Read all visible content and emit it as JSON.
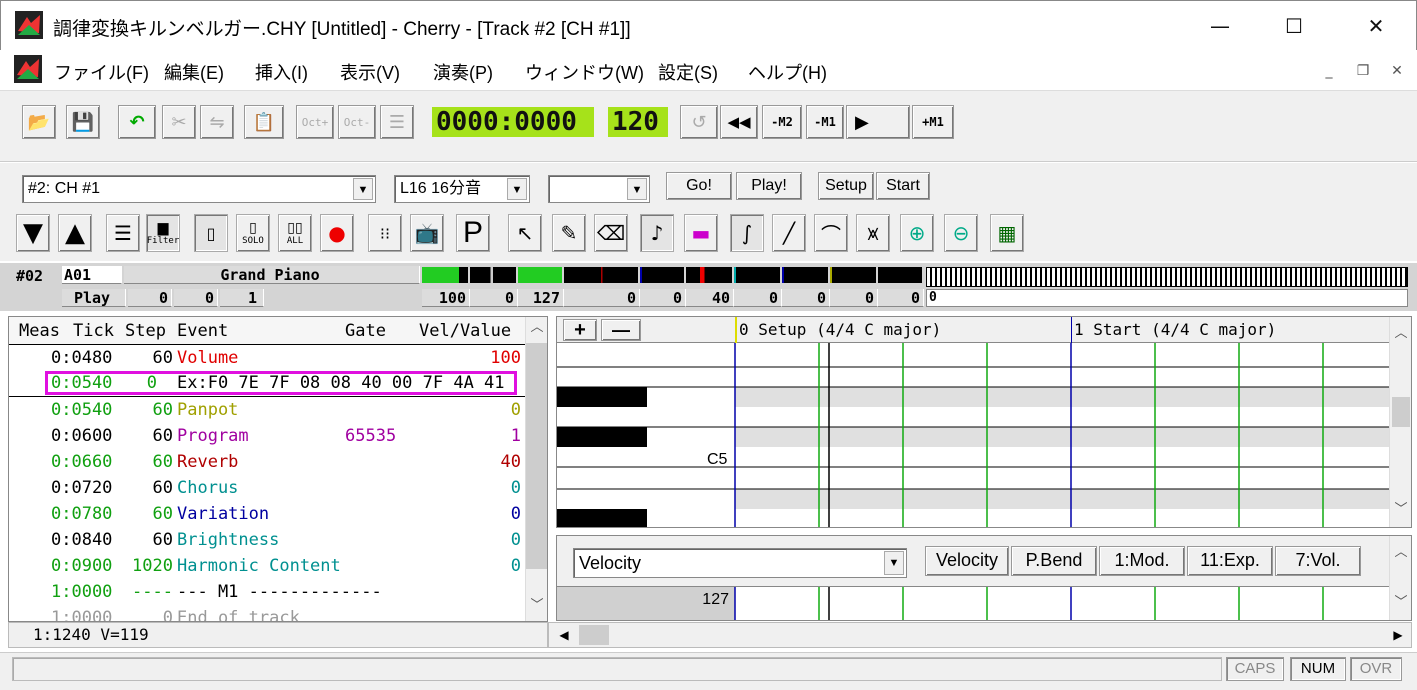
{
  "window": {
    "title": "調律変換キルンベルガー.CHY [Untitled] - Cherry  - [Track #2 [CH #1]]",
    "minimize": "—",
    "maximize": "☐",
    "close": "✕"
  },
  "menu": [
    "ファイル(F)",
    "編集(E)",
    "挿入(I)",
    "表示(V)",
    "演奏(P)",
    "ウィンドウ(W)",
    "設定(S)",
    "ヘルプ(H)"
  ],
  "toolbar": {
    "oct_plus": "Oct+",
    "oct_minus": "Oct-",
    "time": "0000:0000",
    "tempo": "120",
    "m2": "-M2",
    "m1": "-M1",
    "p1": "+M1"
  },
  "track_bar": {
    "track_select": "#2: CH #1",
    "length_select": "L16 16分音",
    "extra_select": "",
    "go": "Go!",
    "play": "Play!",
    "setup": "Setup",
    "start": "Start"
  },
  "tool_labels": {
    "filter": "Filter",
    "solo": "SOLO",
    "all": "ALL",
    "program": "P"
  },
  "strip": {
    "track_no": "#02",
    "port": "A01",
    "instrument": "Grand Piano",
    "mode": "Play",
    "v1": "0",
    "v2": "0",
    "v3": "1",
    "values": [
      "100",
      "0",
      "127",
      "0",
      "0",
      "40",
      "0",
      "0",
      "0",
      "0"
    ],
    "kb_value": "0"
  },
  "event_list": {
    "headers": {
      "meas": "Meas",
      "tick": "Tick",
      "step": "Step",
      "event": "Event",
      "gate": "Gate",
      "vel": "Vel/Value"
    },
    "rows": [
      {
        "meas": "0:0480",
        "step": "60",
        "event": "Volume",
        "gate": "",
        "value": "100",
        "color": "#e00000",
        "meascolor": "#000"
      },
      {
        "meas": "0:0540",
        "step": "0",
        "event": "Ex:F0 7E 7F 08 08 40 00 7F 4A 41",
        "gate": "",
        "value": "",
        "color": "#000",
        "meascolor": "#10a010",
        "selected": true
      },
      {
        "meas": "0:0540",
        "step": "60",
        "event": "Panpot",
        "gate": "",
        "value": "0",
        "color": "#a0a000",
        "meascolor": "#10a010"
      },
      {
        "meas": "0:0600",
        "step": "60",
        "event": "Program",
        "gate": "65535",
        "value": "1",
        "color": "#a000a0",
        "meascolor": "#000"
      },
      {
        "meas": "0:0660",
        "step": "60",
        "event": "Reverb",
        "gate": "",
        "value": "40",
        "color": "#b00000",
        "meascolor": "#10a010"
      },
      {
        "meas": "0:0720",
        "step": "60",
        "event": "Chorus",
        "gate": "",
        "value": "0",
        "color": "#009090",
        "meascolor": "#000"
      },
      {
        "meas": "0:0780",
        "step": "60",
        "event": "Variation",
        "gate": "",
        "value": "0",
        "color": "#0000a0",
        "meascolor": "#10a010"
      },
      {
        "meas": "0:0840",
        "step": "60",
        "event": "Brightness",
        "gate": "",
        "value": "0",
        "color": "#009090",
        "meascolor": "#000"
      },
      {
        "meas": "0:0900",
        "step": "1020",
        "event": "Harmonic Content",
        "gate": "",
        "value": "0",
        "color": "#009090",
        "meascolor": "#10a010"
      },
      {
        "meas": "1:0000",
        "step": "----",
        "event": "--- M1 -------------",
        "gate": "",
        "value": "",
        "color": "#000",
        "meascolor": "#10a010"
      },
      {
        "meas": "1:0000",
        "step": "0",
        "event": "End of track",
        "gate": "",
        "value": "",
        "color": "#999",
        "meascolor": "#999"
      }
    ]
  },
  "piano_roll": {
    "marker1": "0 Setup (4/4 C major)",
    "marker2": "1 Start (4/4 C major)",
    "c5_label": "C5",
    "plus": "+",
    "minus": "—"
  },
  "controller": {
    "selected": "Velocity",
    "buttons": [
      "Velocity",
      "P.Bend",
      "1:Mod.",
      "11:Exp.",
      "7:Vol."
    ],
    "value": "127"
  },
  "position_status": "1:1240 V=119",
  "status": {
    "caps": "CAPS",
    "num": "NUM",
    "ovr": "OVR"
  }
}
